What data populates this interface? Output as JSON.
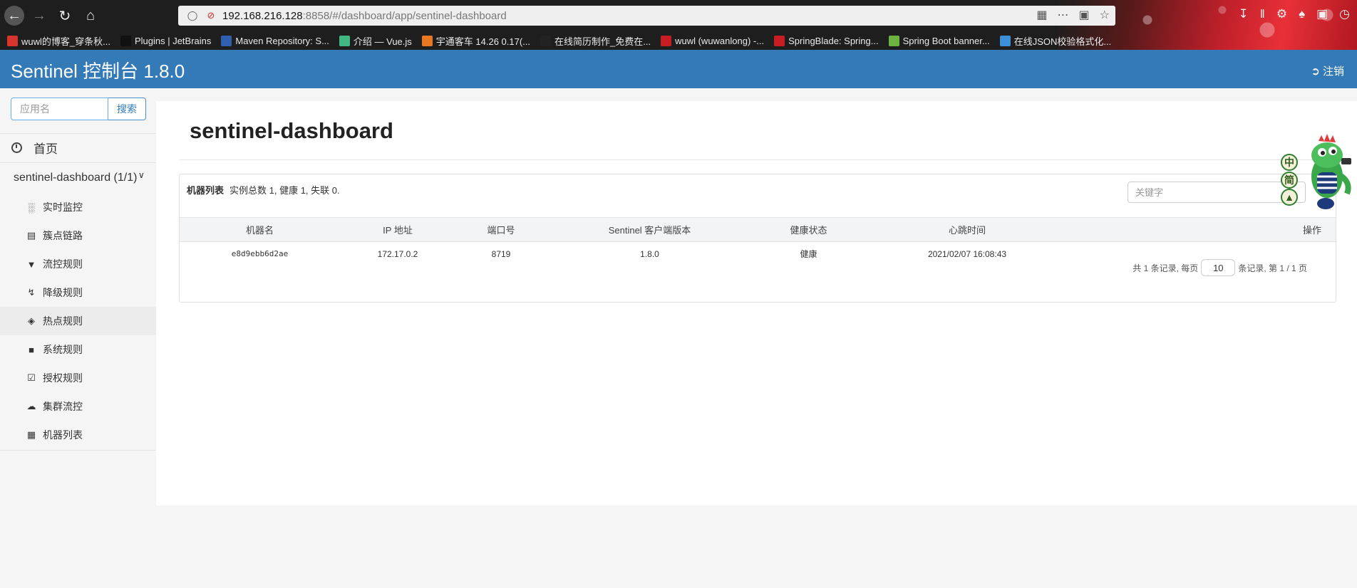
{
  "browser": {
    "url_host": "192.168.216.128",
    "url_path": ":8858/#/dashboard/app/sentinel-dashboard",
    "bookmarks": [
      {
        "label": "wuwl的博客_穿条秋...",
        "color": "#d9342b"
      },
      {
        "label": "Plugins | JetBrains",
        "color": "#111111"
      },
      {
        "label": "Maven Repository: S...",
        "color": "#2f5fae"
      },
      {
        "label": "介绍 — Vue.js",
        "color": "#41b883"
      },
      {
        "label": "宇通客车 14.26 0.17(...",
        "color": "#e87722"
      },
      {
        "label": "在线简历制作_免费在...",
        "color": "#222222"
      },
      {
        "label": "wuwl (wuwanlong) -...",
        "color": "#c71d23"
      },
      {
        "label": "SpringBlade: Spring...",
        "color": "#c71d23"
      },
      {
        "label": "Spring Boot banner...",
        "color": "#6db33f"
      },
      {
        "label": "在线JSON校验格式化...",
        "color": "#3d8fd8"
      }
    ]
  },
  "header": {
    "brand": "Sentinel 控制台 1.8.0",
    "logout_label": "注销"
  },
  "sidebar": {
    "search_placeholder": "应用名",
    "search_button": "搜索",
    "home_label": "首页",
    "app_label": "sentinel-dashboard (1/1)",
    "menu": [
      {
        "label": "实时监控",
        "icon": "bar-chart-icon"
      },
      {
        "label": "簇点链路",
        "icon": "list-icon"
      },
      {
        "label": "流控规则",
        "icon": "filter-icon"
      },
      {
        "label": "降级规则",
        "icon": "flash-icon"
      },
      {
        "label": "热点规则",
        "icon": "fire-icon"
      },
      {
        "label": "系统规则",
        "icon": "lock-icon"
      },
      {
        "label": "授权规则",
        "icon": "check-icon"
      },
      {
        "label": "集群流控",
        "icon": "cloud-icon"
      },
      {
        "label": "机器列表",
        "icon": "grid-icon"
      }
    ]
  },
  "main": {
    "title": "sentinel-dashboard",
    "panel_title": "机器列表",
    "panel_summary": "实例总数 1, 健康 1, 失联 0.",
    "keyword_placeholder": "关键字",
    "columns": [
      "机器名",
      "IP 地址",
      "端口号",
      "Sentinel 客户端版本",
      "健康状态",
      "心跳时间",
      "操作"
    ],
    "rows": [
      [
        "e8d9ebb6d2ae",
        "172.17.0.2",
        "8719",
        "1.8.0",
        "健康",
        "2021/02/07 16:08:43",
        ""
      ]
    ],
    "pager_prefix": "共 1 条记录, 每页",
    "page_size": "10",
    "pager_suffix": "条记录, 第 1 / 1 页"
  },
  "mascot": {
    "badges": [
      "中",
      "简",
      ""
    ]
  },
  "colors": {
    "header_bg": "#337ab7",
    "accent": "#337ab7"
  }
}
